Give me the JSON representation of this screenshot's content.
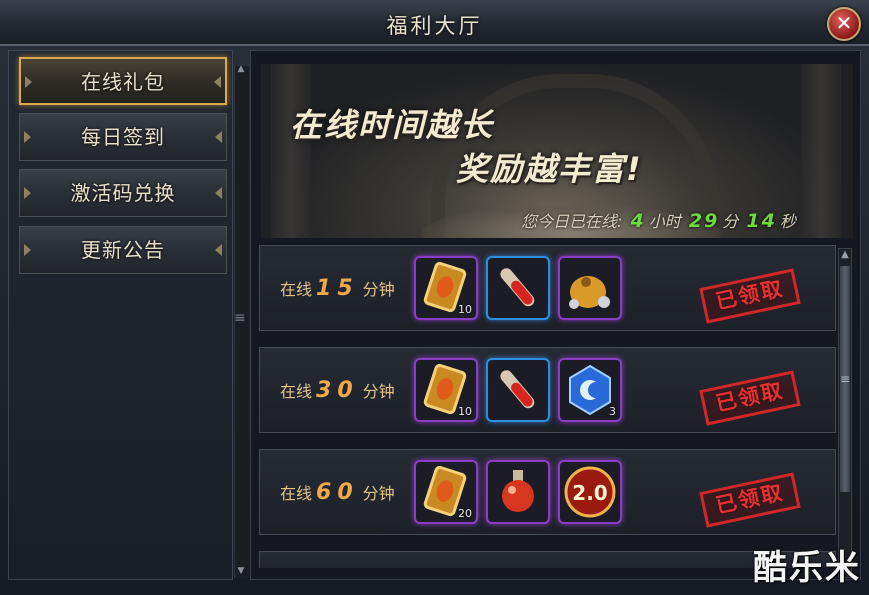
{
  "window": {
    "title": "福利大厅"
  },
  "sidebar": {
    "items": [
      {
        "label": "在线礼包"
      },
      {
        "label": "每日签到"
      },
      {
        "label": "激活码兑换"
      },
      {
        "label": "更新公告"
      }
    ]
  },
  "banner": {
    "slogan_line1": "在线时间越长",
    "slogan_line2": "奖励越丰富!",
    "online_prefix": "您今日已在线:",
    "hours": "4",
    "hours_unit": "小时",
    "minutes": "29",
    "minutes_unit": "分",
    "seconds": "14",
    "seconds_unit": "秒"
  },
  "rewards": [
    {
      "prefix": "在线",
      "minutes": "15",
      "unit": "分钟",
      "status": "已领取",
      "items": [
        {
          "icon": "gold-card-icon",
          "qty": "10"
        },
        {
          "icon": "red-potion-tube-icon",
          "qty": ""
        },
        {
          "icon": "coin-bag-icon",
          "qty": ""
        }
      ]
    },
    {
      "prefix": "在线",
      "minutes": "30",
      "unit": "分钟",
      "status": "已领取",
      "items": [
        {
          "icon": "gold-card-icon",
          "qty": "10"
        },
        {
          "icon": "red-potion-tube-icon",
          "qty": ""
        },
        {
          "icon": "blue-gem-icon",
          "qty": "3"
        }
      ]
    },
    {
      "prefix": "在线",
      "minutes": "60",
      "unit": "分钟",
      "status": "已领取",
      "items": [
        {
          "icon": "gold-card-icon",
          "qty": "20"
        },
        {
          "icon": "red-potion-flask-icon",
          "qty": ""
        },
        {
          "icon": "exp-multiplier-icon",
          "qty": "",
          "badge": "2.0"
        }
      ]
    }
  ],
  "watermark": "酷乐米",
  "colors": {
    "accent_gold": "#d9a94e",
    "stamp_red": "#d0282a",
    "time_green": "#6cdb3e",
    "rare_purple": "#8a3fc2",
    "rare_blue": "#2e8fe0"
  }
}
